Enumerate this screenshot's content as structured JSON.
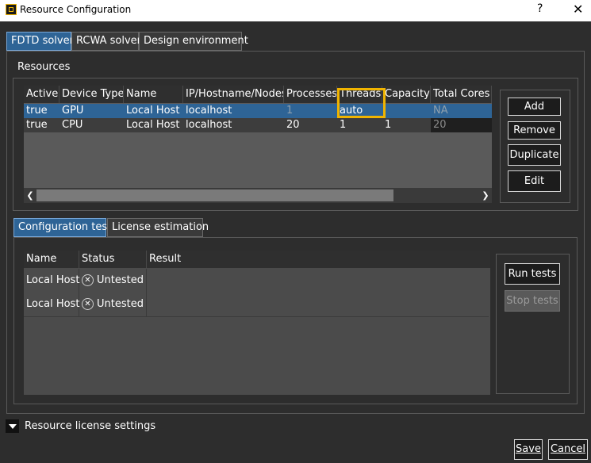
{
  "window": {
    "title": "Resource Configuration",
    "help": "?",
    "close": "✕"
  },
  "tabs": [
    {
      "label": "FDTD solver",
      "active": true
    },
    {
      "label": "RCWA solver",
      "active": false
    },
    {
      "label": "Design environment",
      "active": false
    }
  ],
  "resources": {
    "section_label": "Resources",
    "columns": [
      "Active",
      "Device Type",
      "Name",
      "IP/Hostname/Nodes",
      "Processes",
      "Threads",
      "Capacity",
      "Total Cores"
    ],
    "rows": [
      {
        "active": "true",
        "device": "GPU",
        "name": "Local Host",
        "host": "localhost",
        "processes": "1",
        "threads": "auto",
        "capacity": "",
        "cores": "NA",
        "selected": true
      },
      {
        "active": "true",
        "device": "CPU",
        "name": "Local Host",
        "host": "localhost",
        "processes": "20",
        "threads": "1",
        "capacity": "1",
        "cores": "20",
        "selected": false
      }
    ],
    "scroll_left": "❮",
    "scroll_right": "❯",
    "highlight_color": "#f0b400",
    "selection_color": "#2e6496"
  },
  "resource_buttons": {
    "add": "Add",
    "remove": "Remove",
    "duplicate": "Duplicate",
    "edit": "Edit"
  },
  "subtabs": [
    {
      "label": "Configuration test",
      "active": true
    },
    {
      "label": "License estimation",
      "active": false
    }
  ],
  "tests": {
    "columns": [
      "Name",
      "Status",
      "Result"
    ],
    "rows": [
      {
        "name": "Local Host",
        "status": "Untested",
        "result": ""
      },
      {
        "name": "Local Host",
        "status": "Untested",
        "result": ""
      }
    ],
    "status_icon": "x-circle-icon"
  },
  "test_buttons": {
    "run": "Run tests",
    "stop": "Stop tests",
    "stop_disabled": true
  },
  "license_settings": {
    "label": "Resource license settings",
    "expanded": false
  },
  "footer": {
    "save": "Save",
    "cancel": "Cancel"
  }
}
